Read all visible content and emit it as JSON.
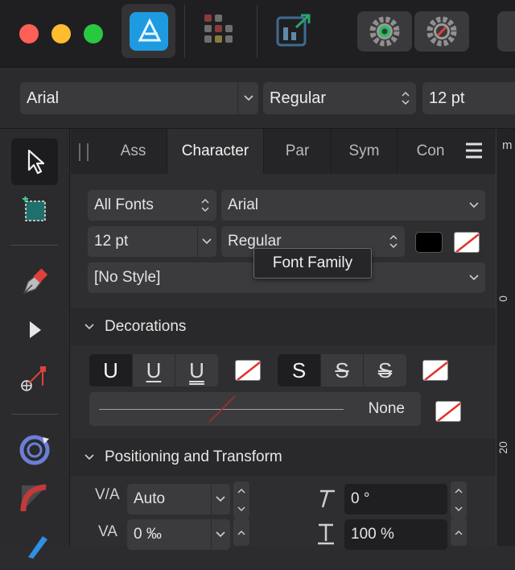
{
  "context_toolbar": {
    "font_family": "Arial",
    "font_style": "Regular",
    "font_size": "12 pt"
  },
  "panel": {
    "tabs": [
      {
        "label": "Ass",
        "active": false
      },
      {
        "label": "Character",
        "active": true
      },
      {
        "label": "Par",
        "active": false
      },
      {
        "label": "Sym",
        "active": false
      },
      {
        "label": "Con",
        "active": false
      }
    ],
    "font_collection": "All Fonts",
    "font_family": "Arial",
    "font_size": "12 pt",
    "font_style": "Regular",
    "text_style": "[No Style]",
    "tooltip": "Font Family",
    "decorations": {
      "title": "Decorations",
      "underline_glyph": "U",
      "strike_glyph": "S",
      "line_style": "None"
    },
    "positioning": {
      "title": "Positioning and Transform",
      "tracking_label": "V/A",
      "tracking_value": "Auto",
      "kerning_label": "VA",
      "kerning_value": "0 ‰",
      "shear_value": "0 °",
      "scale_value": "100 %"
    }
  },
  "ruler": {
    "unit": "m",
    "labels": [
      "0",
      "20"
    ]
  },
  "colors": {
    "accent": "#1e9be0",
    "text_color": "#000000",
    "traffic_close": "#fe5f57",
    "traffic_min": "#febc2e",
    "traffic_max": "#28c840"
  }
}
